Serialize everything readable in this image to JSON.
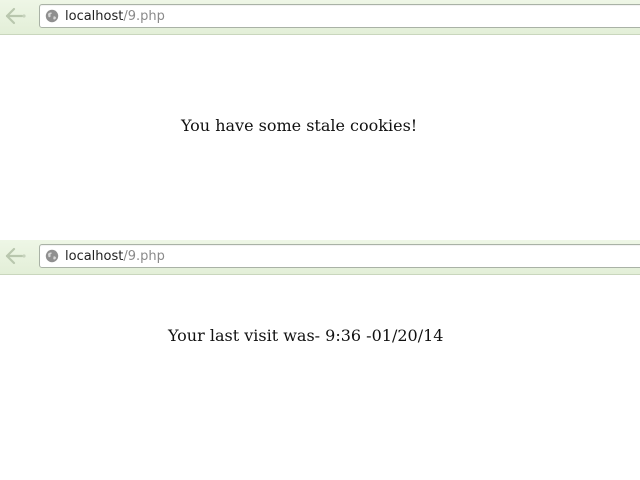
{
  "screens": [
    {
      "url_host": "localhost",
      "url_path": "/9.php",
      "message": "You have some stale cookies!"
    },
    {
      "url_host": "localhost",
      "url_path": "/9.php",
      "message": "Your last visit was- 9:36 -01/20/14"
    }
  ],
  "icons": {
    "back": "back-arrow-icon",
    "site": "globe-icon"
  },
  "colors": {
    "toolbar": "#e8f2df",
    "url_host": "#222222",
    "url_path": "#8a8a8a"
  }
}
